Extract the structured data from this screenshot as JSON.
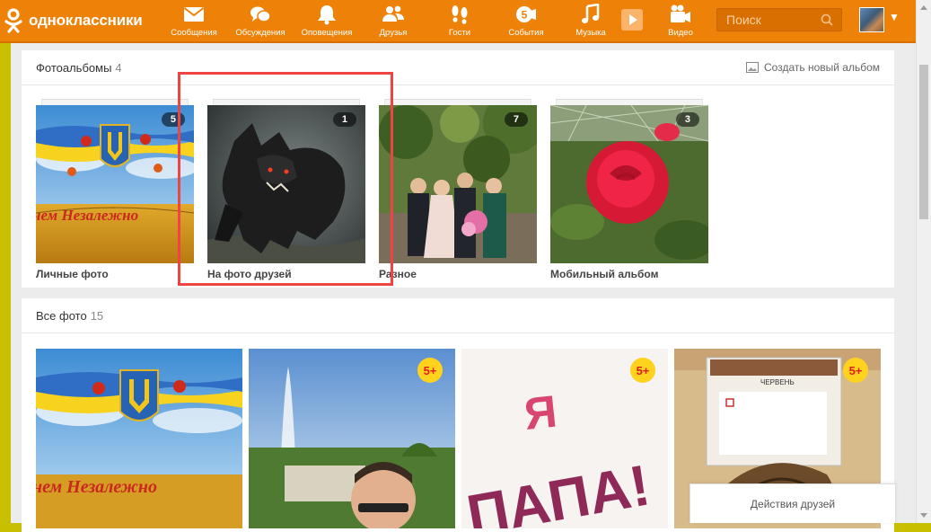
{
  "topbar": {
    "logo_text": "одноклассники",
    "nav": [
      {
        "label": "Сообщения",
        "icon": "envelope-icon"
      },
      {
        "label": "Обсуждения",
        "icon": "chat-bubbles-icon"
      },
      {
        "label": "Оповещения",
        "icon": "bell-icon"
      },
      {
        "label": "Друзья",
        "icon": "friends-icon"
      },
      {
        "label": "Гости",
        "icon": "footprints-icon"
      },
      {
        "label": "События",
        "icon": "events-icon",
        "badge": "5"
      },
      {
        "label": "Музыка",
        "icon": "music-note-icon"
      },
      {
        "label": "Видео",
        "icon": "video-camera-icon"
      }
    ],
    "search_placeholder": "Поиск"
  },
  "albums": {
    "title": "Фотоальбомы",
    "count": "4",
    "create_label": "Создать новый альбом",
    "items": [
      {
        "label": "Личные фото",
        "count": "5",
        "caption_art": "нем Незалежно"
      },
      {
        "label": "На фото друзей",
        "count": "1"
      },
      {
        "label": "Разное",
        "count": "7"
      },
      {
        "label": "Мобильный альбом",
        "count": "3"
      }
    ]
  },
  "photos": {
    "title": "Все фото",
    "count": "15",
    "items": [
      {
        "badge": "",
        "caption_art": "нем Незалежно"
      },
      {
        "badge": "5+"
      },
      {
        "badge": "5+",
        "art_text_1": "Я",
        "art_text_2": "ПАПА!"
      },
      {
        "badge": "5+",
        "art_text": "ЧЕРВЕНЬ"
      }
    ]
  },
  "friends_actions_label": "Действия друзей",
  "colors": {
    "brand_orange": "#ee8208",
    "highlight_red": "#ef4444",
    "badge_yellow": "#ffd21e"
  }
}
